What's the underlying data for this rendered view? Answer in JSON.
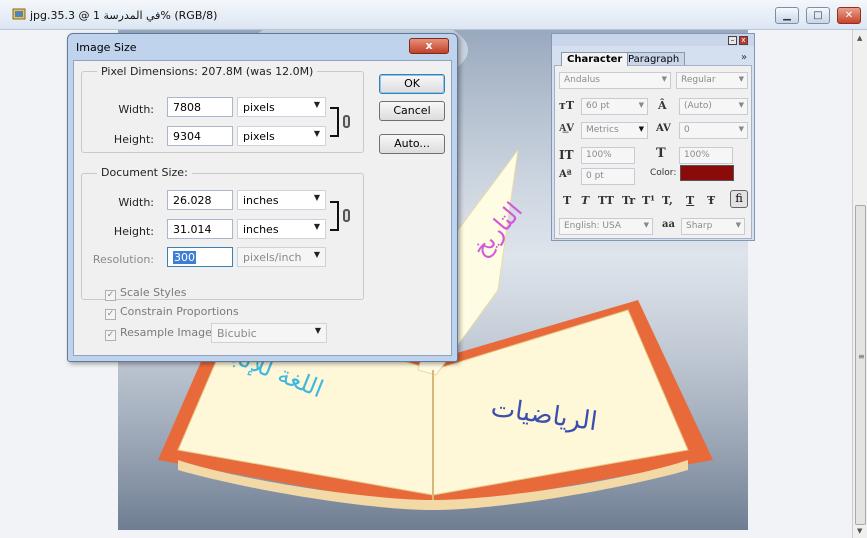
{
  "document": {
    "title": "jpg.في المدرسة 1 @ 35.3% (RGB/8)"
  },
  "image_size_dialog": {
    "title": "Image Size",
    "close_label": "x",
    "pixel_dimensions": {
      "legend": "Pixel Dimensions:  207.8M (was 12.0M)",
      "width_label": "Width:",
      "width_value": "7808",
      "width_unit": "pixels",
      "height_label": "Height:",
      "height_value": "9304",
      "height_unit": "pixels"
    },
    "document_size": {
      "legend": "Document Size:",
      "width_label": "Width:",
      "width_value": "26.028",
      "width_unit": "inches",
      "height_label": "Height:",
      "height_value": "31.014",
      "height_unit": "inches",
      "resolution_label": "Resolution:",
      "resolution_value": "300",
      "resolution_unit": "pixels/inch"
    },
    "buttons": {
      "ok": "OK",
      "cancel": "Cancel",
      "auto": "Auto..."
    },
    "options": {
      "scale_styles": "Scale Styles",
      "constrain_proportions": "Constrain Proportions",
      "resample_label": "Resample Image:",
      "resample_value": "Bicubic",
      "scale_styles_checked": true,
      "constrain_checked": true,
      "resample_checked": true
    }
  },
  "character_panel": {
    "tabs": [
      "Character",
      "Paragraph"
    ],
    "more": "»",
    "font_family": "Andalus",
    "font_style": "Regular",
    "font_size": "60 pt",
    "leading": "(Auto)",
    "kerning": "Metrics",
    "tracking": "0",
    "vertical_scale": "100%",
    "horizontal_scale": "100%",
    "baseline_shift": "0 pt",
    "color_label": "Color:",
    "color_value": "#8b0a0a",
    "language": "English: USA",
    "antialias_glyph": "aa",
    "antialias": "Sharp",
    "style_buttons": [
      "T",
      "T",
      "TT",
      "Tr",
      "T¹",
      "T,",
      "T",
      "Ŧ"
    ],
    "fraction_button": "fi"
  },
  "artwork_text": {
    "history": "التاريخ",
    "english": "اللغة للإنجليزية",
    "math": "الرياضيات"
  }
}
